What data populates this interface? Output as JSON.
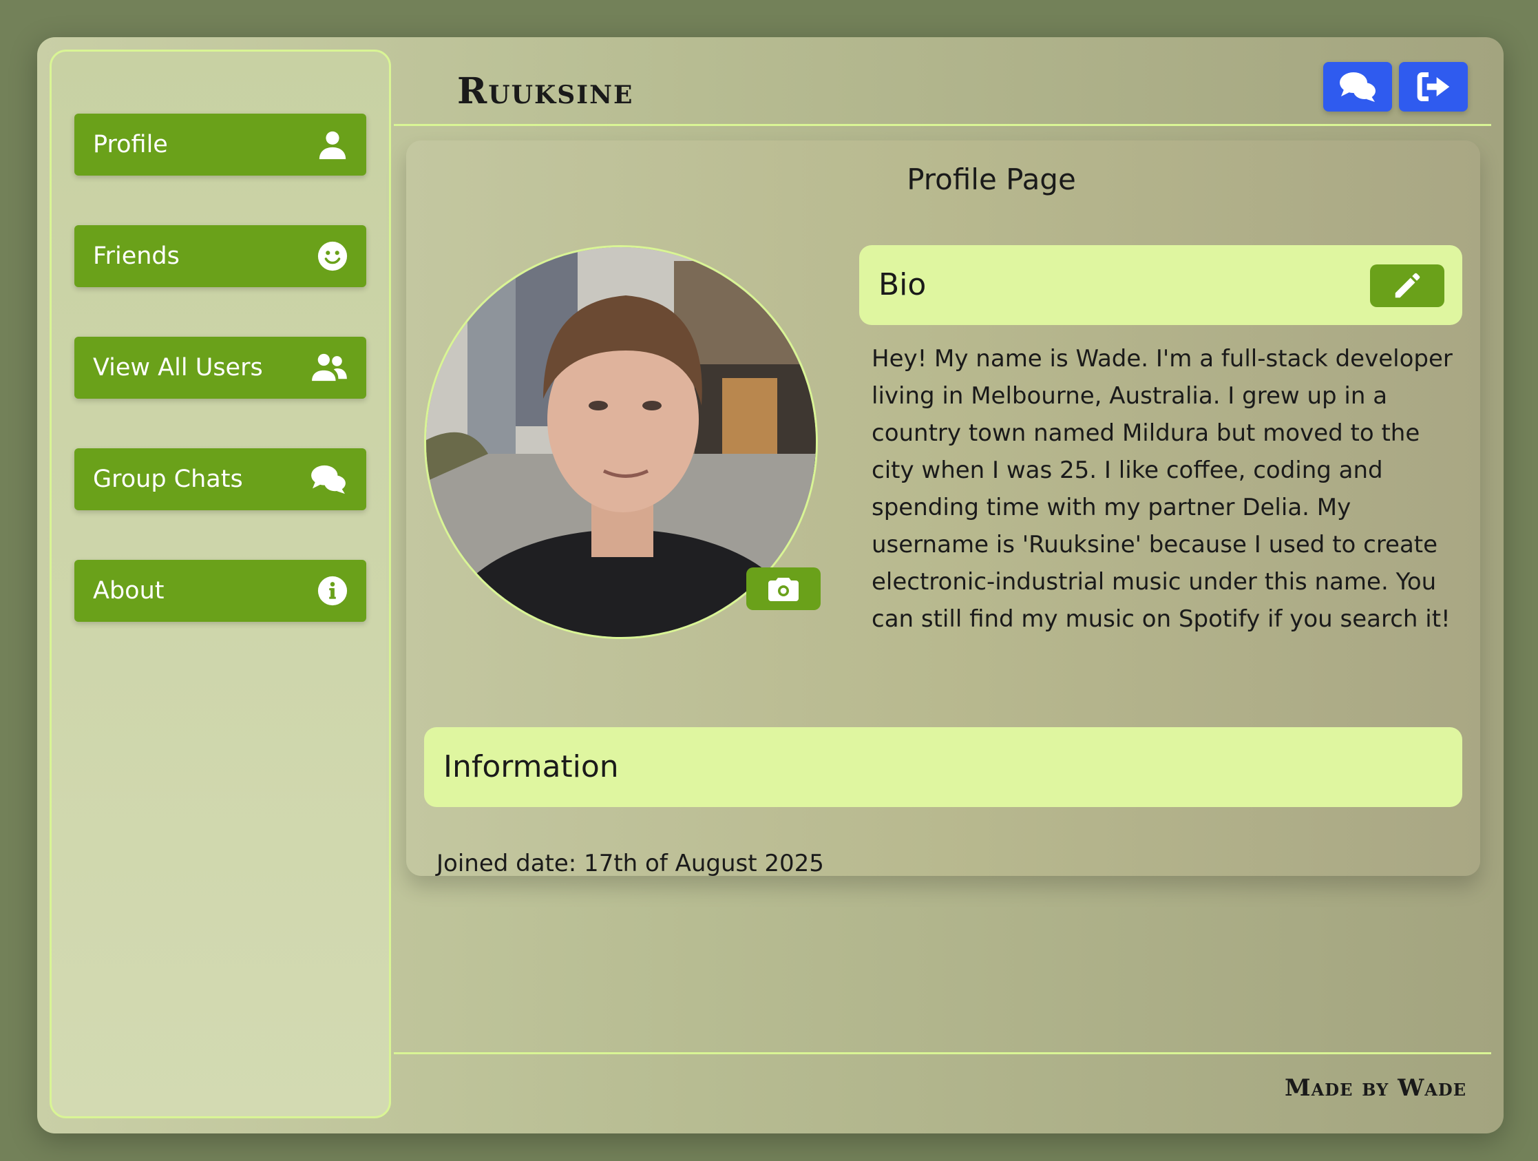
{
  "app": {
    "title": "Ruuksine",
    "footer": "Made by Wade"
  },
  "sidebar": {
    "items": [
      {
        "label": "Profile",
        "icon": "user-icon"
      },
      {
        "label": "Friends",
        "icon": "smile-icon"
      },
      {
        "label": "View All Users",
        "icon": "users-icon"
      },
      {
        "label": "Group Chats",
        "icon": "comments-icon"
      },
      {
        "label": "About",
        "icon": "info-icon"
      }
    ]
  },
  "header": {
    "buttons": [
      {
        "icon": "comments-icon"
      },
      {
        "icon": "sign-out-icon"
      }
    ]
  },
  "profile": {
    "page_title": "Profile Page",
    "bio_heading": "Bio",
    "bio_text": "Hey! My name is Wade. I'm a full-stack developer living in Melbourne, Australia. I grew up in a country town named Mildura but moved to the city when I was 25. I like coffee, coding and spending time with my partner Delia. My username is 'Ruuksine' because I used to create electronic-industrial music under this name. You can still find my music on Spotify if you search it!",
    "info_heading": "Information",
    "joined": "Joined date: 17th of August 2025"
  },
  "colors": {
    "accent_green": "#6aa11a",
    "light_green": "#dff6a0",
    "blue": "#2f5bef"
  }
}
